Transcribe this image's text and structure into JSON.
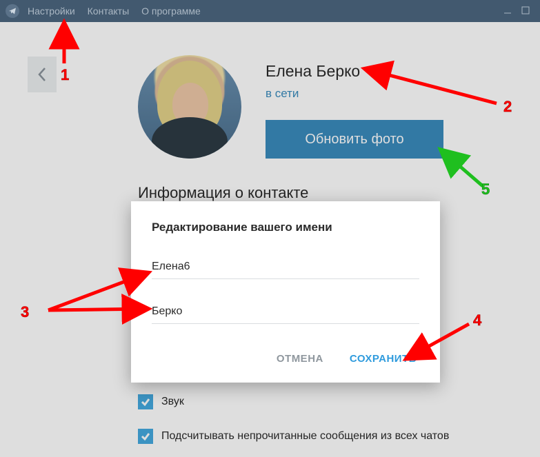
{
  "titlebar": {
    "menu": [
      "Настройки",
      "Контакты",
      "О программе"
    ]
  },
  "profile": {
    "name": "Елена Берко",
    "status": "в сети",
    "update_photo_label": "Обновить фото"
  },
  "section_title": "Информация о контакте",
  "settings": {
    "sound_label": "Звук",
    "unread_label": "Подсчитывать непрочитанные сообщения из всех чатов"
  },
  "modal": {
    "title": "Редактирование вашего имени",
    "first_name": "Елена6",
    "last_name": "Берко",
    "cancel_label": "ОТМЕНА",
    "save_label": "СОХРАНИТЬ"
  },
  "annotations": {
    "n1": "1",
    "n2": "2",
    "n3": "3",
    "n4": "4",
    "n5": "5"
  }
}
